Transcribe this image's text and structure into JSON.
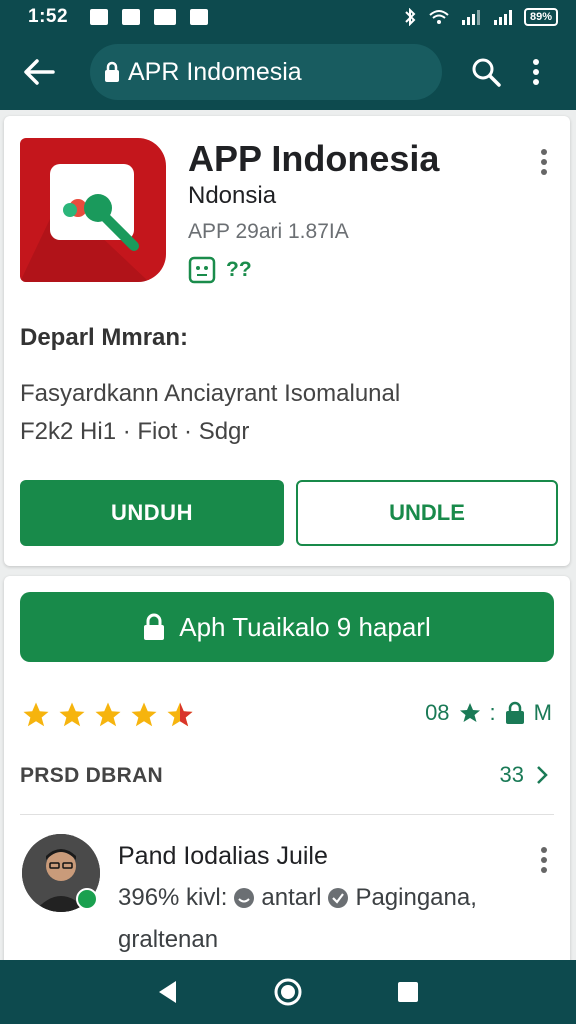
{
  "status_bar": {
    "time": "1:52",
    "battery": "89%"
  },
  "app_bar": {
    "url": "APR Indomesia",
    "icons": [
      "back-arrow-icon",
      "lock-icon",
      "search-icon",
      "more-vert-icon"
    ]
  },
  "app": {
    "title": "APP Indonesia",
    "developer": "Ndonsia",
    "meta": "APP 29ari 1.87IA",
    "badge_text": "??",
    "section_title": "Deparl Mmran:",
    "desc_line1": "Fasyardkann Anciayrant Isomalunal",
    "desc_line2": "F2k2  Hi1  ·  Fiot  ·  Sdgr",
    "primary_button": "UNDUH",
    "secondary_button": "UNDLE",
    "brand_color": "#188a4a"
  },
  "detail": {
    "wide_button": "Aph Tuaikalo 9 haparl",
    "rating_stars": 4.5,
    "stat_text": "08",
    "stat_suffix": "M",
    "reviews_label": "PRSD DBRAN",
    "reviews_count": "33",
    "review": {
      "name": "Pand Iodalias Juile",
      "meta_prefix": "396% kivl:",
      "meta_mid": "antarl",
      "meta_suffix": "Pagingana,",
      "meta_line2": "graltenan"
    }
  }
}
